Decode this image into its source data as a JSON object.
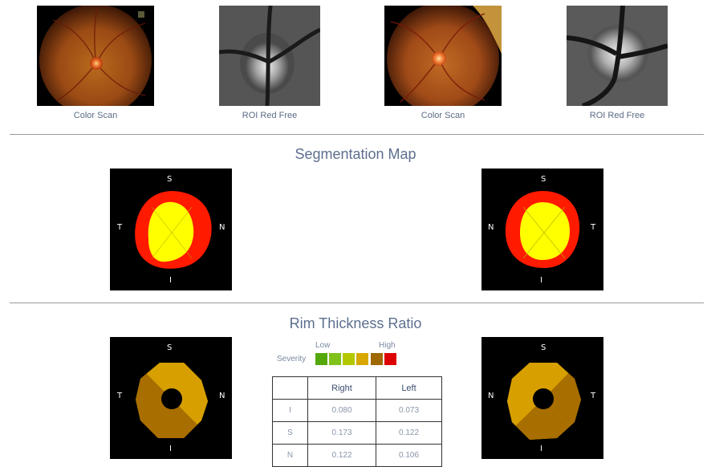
{
  "scans": [
    {
      "label": "Color Scan"
    },
    {
      "label": "ROI Red Free"
    },
    {
      "label": "Color Scan"
    },
    {
      "label": "ROI Red Free"
    }
  ],
  "segmentation": {
    "title": "Segmentation Map",
    "right": {
      "top": "S",
      "bottom": "I",
      "left": "T",
      "right": "N"
    },
    "left": {
      "top": "S",
      "bottom": "I",
      "left": "N",
      "right": "T"
    }
  },
  "rim": {
    "title": "Rim Thickness Ratio",
    "right": {
      "top": "S",
      "bottom": "I",
      "left": "T",
      "right": "N"
    },
    "left": {
      "top": "S",
      "bottom": "I",
      "left": "N",
      "right": "T"
    },
    "severity": {
      "label": "Severity",
      "low": "Low",
      "high": "High",
      "colors": [
        "#55a80c",
        "#7fc21a",
        "#b4c800",
        "#d8a800",
        "#a06800",
        "#dd0000"
      ]
    },
    "table": {
      "headers": [
        "",
        "Right",
        "Left"
      ],
      "rows": [
        {
          "key": "I",
          "right": "0.080",
          "left": "0.073"
        },
        {
          "key": "S",
          "right": "0.173",
          "left": "0.122"
        },
        {
          "key": "N",
          "right": "0.122",
          "left": "0.106"
        }
      ]
    }
  },
  "colors": {
    "cup": "#ffff00",
    "disc": "#ff1a00",
    "rim_light": "#d7a000",
    "rim_dark": "#a86e00",
    "divider": "#9a9a9a"
  }
}
